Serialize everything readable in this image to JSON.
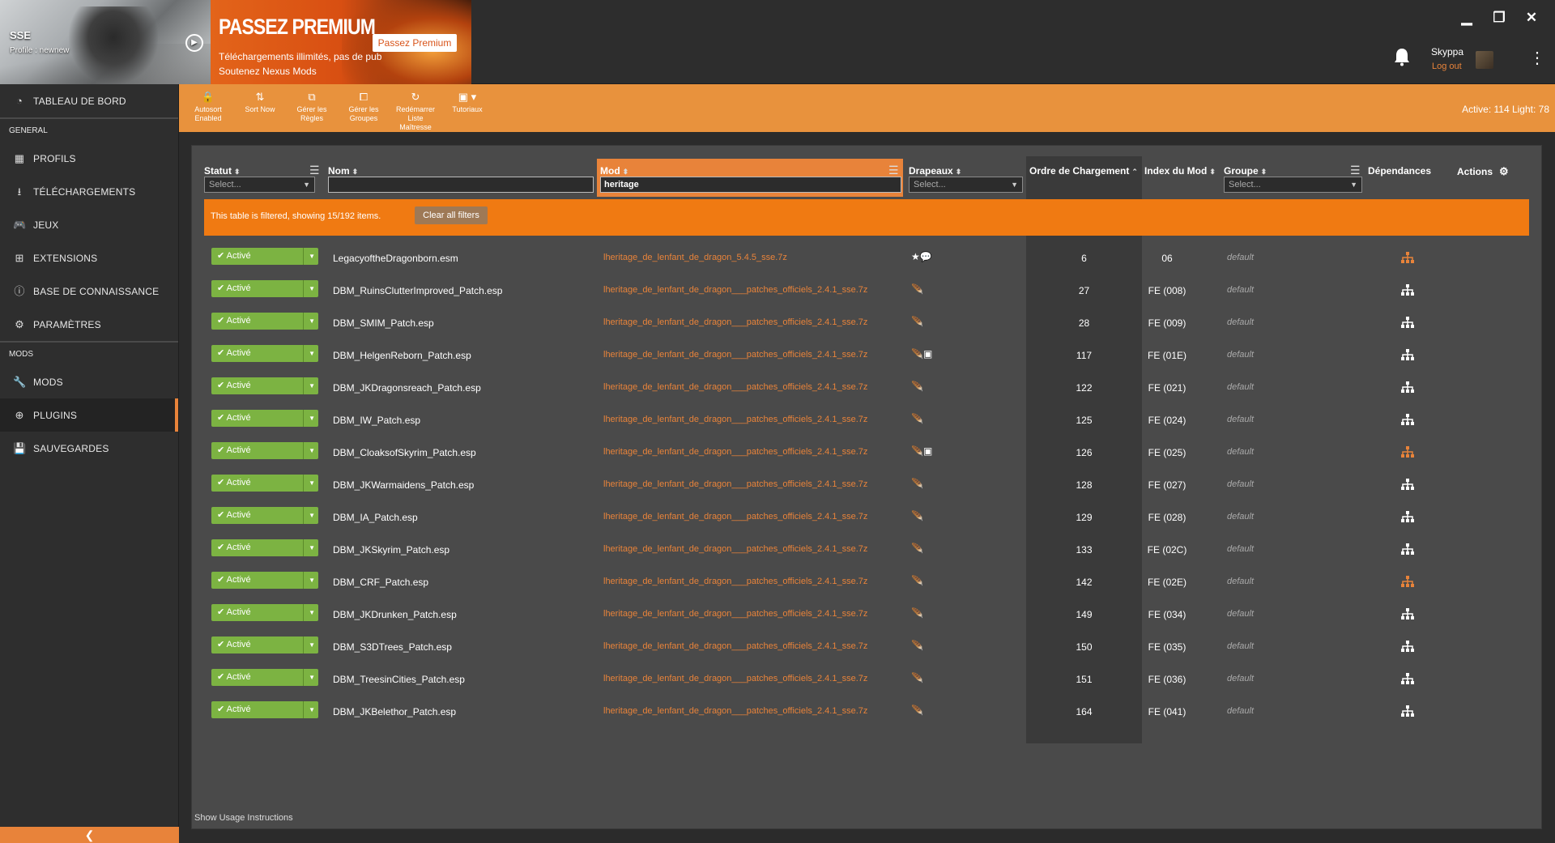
{
  "game": {
    "title": "SSE",
    "profile": "Profile : newnew"
  },
  "premium": {
    "title": "PASSEZ PREMIUM",
    "button": "Passez Premium",
    "line1": "Téléchargements illimités, pas de pub",
    "line2": "Soutenez Nexus Mods"
  },
  "user": {
    "name": "Skyppa",
    "logout": "Log out"
  },
  "window": {
    "minimize": "▁",
    "restore": "❐",
    "close": "✕"
  },
  "sidebar": {
    "top_item": {
      "label": "TABLEAU DE BORD",
      "icon": "dashboard-icon"
    },
    "section_general": "GENERAL",
    "general_items": [
      {
        "label": "PROFILS",
        "icon": "profiles-icon"
      },
      {
        "label": "TÉLÉCHARGEMENTS",
        "icon": "download-icon"
      },
      {
        "label": "JEUX",
        "icon": "gamepad-icon"
      },
      {
        "label": "EXTENSIONS",
        "icon": "extensions-icon"
      },
      {
        "label": "BASE DE CONNAISSANCE",
        "icon": "info-icon"
      },
      {
        "label": "PARAMÈTRES",
        "icon": "gear-icon"
      }
    ],
    "section_mods": "MODS",
    "mods_items": [
      {
        "label": "MODS",
        "icon": "wrench-icon"
      },
      {
        "label": "PLUGINS",
        "icon": "plus-circle-icon",
        "active": true
      },
      {
        "label": "SAUVEGARDES",
        "icon": "save-icon"
      }
    ]
  },
  "toolbar": {
    "buttons": [
      {
        "label": "Autosort Enabled",
        "icon": "lock-icon"
      },
      {
        "label": "Sort Now",
        "icon": "sort-icon"
      },
      {
        "label": "Gérer les Règles",
        "icon": "rules-icon"
      },
      {
        "label": "Gérer les Groupes",
        "icon": "groups-icon"
      },
      {
        "label": "Redémarrer Liste Maîtresse",
        "icon": "refresh-icon"
      },
      {
        "label": "Tutoriaux",
        "icon": "video-icon"
      }
    ],
    "active_count": "Active: 114 Light: 78"
  },
  "table": {
    "headers": {
      "status": "Statut",
      "name": "Nom",
      "mod": "Mod",
      "flags": "Drapeaux",
      "load_order": "Ordre de Chargement",
      "mod_index": "Index du Mod",
      "group": "Groupe",
      "dependencies": "Dépendances",
      "actions": "Actions"
    },
    "filters": {
      "status_placeholder": "Select...",
      "name_value": "",
      "mod_value": "heritage",
      "flags_placeholder": "Select...",
      "group_placeholder": "Select..."
    },
    "banner": {
      "text": "This table is filtered, showing 15/192 items.",
      "clear": "Clear all filters"
    },
    "rows": [
      {
        "status": "Activé",
        "name": "LegacyoftheDragonborn.esm",
        "mod": "lheritage_de_lenfant_de_dragon_5.4.5_sse.7z",
        "flags": "★💬",
        "order": "6",
        "index": "06",
        "group": "default",
        "dep_highlight": true
      },
      {
        "status": "Activé",
        "name": "DBM_RuinsClutterImproved_Patch.esp",
        "mod": "lheritage_de_lenfant_de_dragon___patches_officiels_2.4.1_sse.7z",
        "flags": "🪶",
        "order": "27",
        "index": "FE (008)",
        "group": "default",
        "dep_highlight": false
      },
      {
        "status": "Activé",
        "name": "DBM_SMIM_Patch.esp",
        "mod": "lheritage_de_lenfant_de_dragon___patches_officiels_2.4.1_sse.7z",
        "flags": "🪶",
        "order": "28",
        "index": "FE (009)",
        "group": "default",
        "dep_highlight": false
      },
      {
        "status": "Activé",
        "name": "DBM_HelgenReborn_Patch.esp",
        "mod": "lheritage_de_lenfant_de_dragon___patches_officiels_2.4.1_sse.7z",
        "flags": "🪶▣",
        "order": "117",
        "index": "FE (01E)",
        "group": "default",
        "dep_highlight": false
      },
      {
        "status": "Activé",
        "name": "DBM_JKDragonsreach_Patch.esp",
        "mod": "lheritage_de_lenfant_de_dragon___patches_officiels_2.4.1_sse.7z",
        "flags": "🪶",
        "order": "122",
        "index": "FE (021)",
        "group": "default",
        "dep_highlight": false
      },
      {
        "status": "Activé",
        "name": "DBM_IW_Patch.esp",
        "mod": "lheritage_de_lenfant_de_dragon___patches_officiels_2.4.1_sse.7z",
        "flags": "🪶",
        "order": "125",
        "index": "FE (024)",
        "group": "default",
        "dep_highlight": false
      },
      {
        "status": "Activé",
        "name": "DBM_CloaksofSkyrim_Patch.esp",
        "mod": "lheritage_de_lenfant_de_dragon___patches_officiels_2.4.1_sse.7z",
        "flags": "🪶▣",
        "order": "126",
        "index": "FE (025)",
        "group": "default",
        "dep_highlight": true
      },
      {
        "status": "Activé",
        "name": "DBM_JKWarmaidens_Patch.esp",
        "mod": "lheritage_de_lenfant_de_dragon___patches_officiels_2.4.1_sse.7z",
        "flags": "🪶",
        "order": "128",
        "index": "FE (027)",
        "group": "default",
        "dep_highlight": false
      },
      {
        "status": "Activé",
        "name": "DBM_IA_Patch.esp",
        "mod": "lheritage_de_lenfant_de_dragon___patches_officiels_2.4.1_sse.7z",
        "flags": "🪶",
        "order": "129",
        "index": "FE (028)",
        "group": "default",
        "dep_highlight": false
      },
      {
        "status": "Activé",
        "name": "DBM_JKSkyrim_Patch.esp",
        "mod": "lheritage_de_lenfant_de_dragon___patches_officiels_2.4.1_sse.7z",
        "flags": "🪶",
        "order": "133",
        "index": "FE (02C)",
        "group": "default",
        "dep_highlight": false
      },
      {
        "status": "Activé",
        "name": "DBM_CRF_Patch.esp",
        "mod": "lheritage_de_lenfant_de_dragon___patches_officiels_2.4.1_sse.7z",
        "flags": "🪶",
        "order": "142",
        "index": "FE (02E)",
        "group": "default",
        "dep_highlight": true
      },
      {
        "status": "Activé",
        "name": "DBM_JKDrunken_Patch.esp",
        "mod": "lheritage_de_lenfant_de_dragon___patches_officiels_2.4.1_sse.7z",
        "flags": "🪶",
        "order": "149",
        "index": "FE (034)",
        "group": "default",
        "dep_highlight": false
      },
      {
        "status": "Activé",
        "name": "DBM_S3DTrees_Patch.esp",
        "mod": "lheritage_de_lenfant_de_dragon___patches_officiels_2.4.1_sse.7z",
        "flags": "🪶",
        "order": "150",
        "index": "FE (035)",
        "group": "default",
        "dep_highlight": false
      },
      {
        "status": "Activé",
        "name": "DBM_TreesinCities_Patch.esp",
        "mod": "lheritage_de_lenfant_de_dragon___patches_officiels_2.4.1_sse.7z",
        "flags": "🪶",
        "order": "151",
        "index": "FE (036)",
        "group": "default",
        "dep_highlight": false
      },
      {
        "status": "Activé",
        "name": "DBM_JKBelethor_Patch.esp",
        "mod": "lheritage_de_lenfant_de_dragon___patches_officiels_2.4.1_sse.7z",
        "flags": "🪶",
        "order": "164",
        "index": "FE (041)",
        "group": "default",
        "dep_highlight": false
      }
    ],
    "usage": "Show Usage Instructions"
  },
  "colors": {
    "accent": "#e8833a",
    "status_green": "#7cb342",
    "banner": "#f07a12",
    "toolbar": "#e8923d"
  }
}
